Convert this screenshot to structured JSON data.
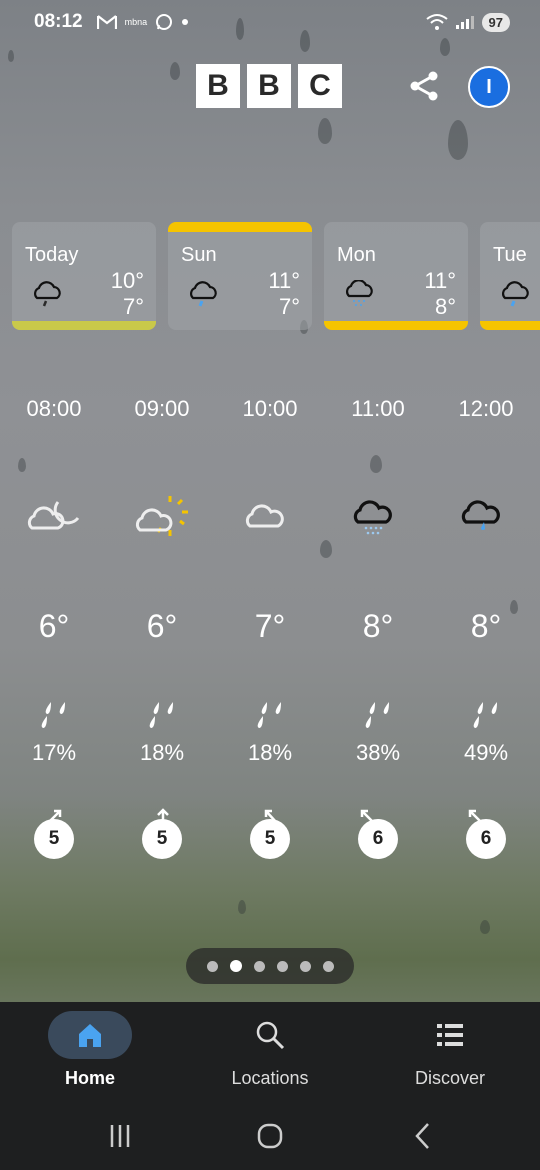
{
  "status_bar": {
    "time": "08:12",
    "battery": "97",
    "carrier_small": "mbna"
  },
  "header": {
    "logo_letters": [
      "B",
      "B",
      "C"
    ],
    "avatar_initial": "I"
  },
  "days": [
    {
      "name": "Today",
      "high": "10°",
      "low": "7°",
      "icon": "light-rain-cloud-icon"
    },
    {
      "name": "Sun",
      "high": "11°",
      "low": "7°",
      "icon": "light-rain-cloud-icon"
    },
    {
      "name": "Mon",
      "high": "11°",
      "low": "8°",
      "icon": "drizzle-cloud-icon"
    },
    {
      "name": "Tue",
      "high": "",
      "low": "",
      "icon": "light-rain-cloud-icon"
    }
  ],
  "hours": [
    {
      "time": "08:00",
      "icon": "partly-cloudy-night-icon",
      "temp": "6°",
      "rain": "17%",
      "wind": "5"
    },
    {
      "time": "09:00",
      "icon": "sunny-intervals-icon",
      "temp": "6°",
      "rain": "18%",
      "wind": "5"
    },
    {
      "time": "10:00",
      "icon": "cloud-icon",
      "temp": "7°",
      "rain": "18%",
      "wind": "5"
    },
    {
      "time": "11:00",
      "icon": "drizzle-cloud-icon",
      "temp": "8°",
      "rain": "38%",
      "wind": "6"
    },
    {
      "time": "12:00",
      "icon": "light-rain-cloud-icon",
      "temp": "8°",
      "rain": "49%",
      "wind": "6"
    }
  ],
  "pager": {
    "count": 6,
    "active_index": 1
  },
  "nav": {
    "home": "Home",
    "locations": "Locations",
    "discover": "Discover"
  },
  "colors": {
    "accent_yellow": "#f5c400",
    "avatar_blue": "#1a6ee0",
    "nav_bg": "#1e1f20",
    "home_icon": "#4aa3f0"
  }
}
